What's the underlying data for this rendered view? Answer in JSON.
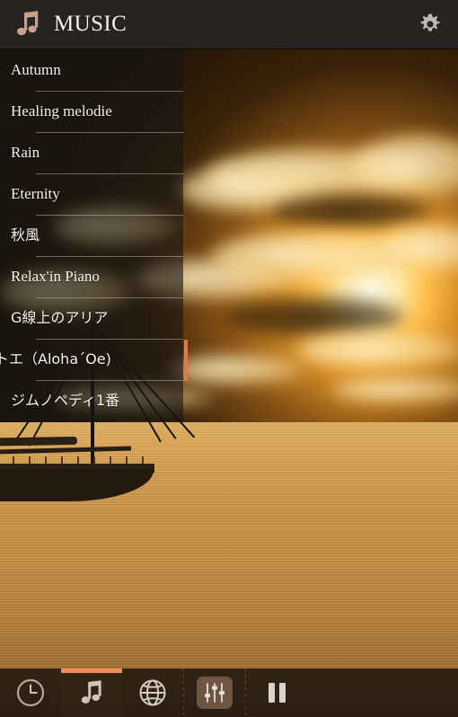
{
  "app": {
    "title": "MUSIC",
    "accent_color": "#e2794a",
    "active_tab_bar_color": "#ef8e57",
    "header_bg": "#262321",
    "list_text_color": "#f4f2ee"
  },
  "header": {
    "title": "MUSIC",
    "note_icon": "music-note-icon",
    "settings_icon": "gear-icon"
  },
  "tracklist": {
    "items": [
      {
        "title": "Autumn",
        "lang": "en"
      },
      {
        "title": "Healing melodie",
        "lang": "en"
      },
      {
        "title": "Rain",
        "lang": "en"
      },
      {
        "title": "Eternity",
        "lang": "en"
      },
      {
        "title": "秋風",
        "lang": "jp"
      },
      {
        "title": "Relax'in Piano",
        "lang": "en"
      },
      {
        "title": "G線上のアリア",
        "lang": "jp"
      },
      {
        "title": "トエ（Aloha´Oe)",
        "lang": "jp",
        "clipped": true
      },
      {
        "title": "ジムノペディ1番",
        "lang": "jp"
      }
    ]
  },
  "scrollbar": {
    "thumb_color": "#e2794a",
    "position_label": "scroll-thumb"
  },
  "bottom_nav": {
    "items": [
      {
        "label": "Timer",
        "icon": "clock-icon",
        "active": false
      },
      {
        "label": "Music",
        "icon": "music-note-icon",
        "active": true
      },
      {
        "label": "Internet",
        "icon": "globe-icon",
        "active": false
      },
      {
        "label": "Equalizer",
        "icon": "equalizer-icon",
        "active": false
      },
      {
        "label": "Pause",
        "icon": "pause-icon",
        "active": false
      }
    ]
  },
  "background": {
    "description": "sunset-over-sea-with-sailboat"
  }
}
